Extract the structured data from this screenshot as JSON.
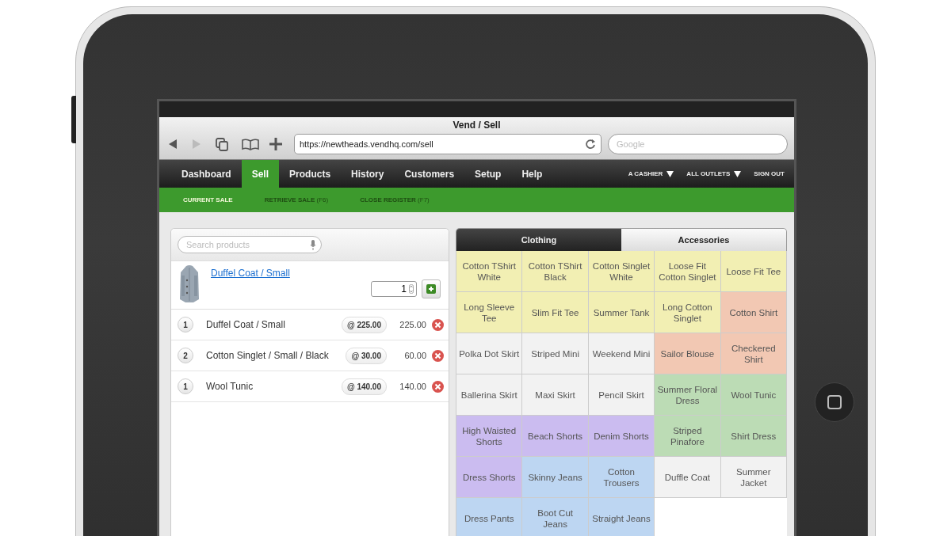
{
  "browser": {
    "title": "Vend / Sell",
    "url": "https://newtheads.vendhq.com/sell",
    "search_placeholder": "Google"
  },
  "nav": {
    "items": [
      {
        "label": "Dashboard",
        "selected": false
      },
      {
        "label": "Sell",
        "selected": true
      },
      {
        "label": "Products",
        "selected": false
      },
      {
        "label": "History",
        "selected": false
      },
      {
        "label": "Customers",
        "selected": false
      },
      {
        "label": "Setup",
        "selected": false
      },
      {
        "label": "Help",
        "selected": false
      }
    ],
    "menus": [
      {
        "label": "A CASHIER",
        "dropdown": true
      },
      {
        "label": "ALL OUTLETS",
        "dropdown": true
      },
      {
        "label": "SIGN OUT",
        "dropdown": false
      }
    ]
  },
  "subnav": [
    {
      "label": "CURRENT SALE",
      "selected": true
    },
    {
      "label": "RETRIEVE SALE",
      "shortcut": "(F6)",
      "selected": false
    },
    {
      "label": "CLOSE REGISTER",
      "shortcut": "(F7)",
      "selected": false
    }
  ],
  "sale": {
    "search_placeholder": "Search products",
    "product": {
      "kind": "picture",
      "name": "Duffel Coat / Small",
      "quantity": "1"
    },
    "lines": [
      {
        "quantity": "1",
        "name": "Duffel Coat / Small",
        "price": "@ 225.00",
        "total": "225.00"
      },
      {
        "quantity": "2",
        "name": "Cotton Singlet / Small / Black",
        "price": "@ 30.00",
        "total": "60.00"
      },
      {
        "quantity": "1",
        "name": "Wool Tunic",
        "price": "@ 140.00",
        "total": "140.00"
      }
    ]
  },
  "tabs": [
    {
      "label": "Clothing",
      "selected": true
    },
    {
      "label": "Accessories",
      "selected": false
    }
  ],
  "products": [
    {
      "label": "Cotton TShirt White",
      "color": "#f2efb3"
    },
    {
      "label": "Cotton TShirt Black",
      "color": "#f2efb3"
    },
    {
      "label": "Cotton Singlet White",
      "color": "#f2efb3"
    },
    {
      "label": "Loose Fit Cotton Singlet",
      "color": "#f2efb3"
    },
    {
      "label": "Loose Fit Tee",
      "color": "#f2efb3"
    },
    {
      "label": "Long Sleeve Tee",
      "color": "#f2efb3"
    },
    {
      "label": "Slim Fit Tee",
      "color": "#f2efb3"
    },
    {
      "label": "Summer Tank",
      "color": "#f2efb3"
    },
    {
      "label": "Long Cotton Singlet",
      "color": "#f2efb3"
    },
    {
      "label": "Cotton Shirt",
      "color": "#f2c8b3"
    },
    {
      "label": "Polka Dot Skirt",
      "color": "#f2f2f2"
    },
    {
      "label": "Striped Mini",
      "color": "#f2f2f2"
    },
    {
      "label": "Weekend Mini",
      "color": "#f2f2f2"
    },
    {
      "label": "Sailor Blouse",
      "color": "#f2c8b3"
    },
    {
      "label": "Checkered Shirt",
      "color": "#f2c8b3"
    },
    {
      "label": "Ballerina Skirt",
      "color": "#f2f2f2"
    },
    {
      "label": "Maxi Skirt",
      "color": "#f2f2f2"
    },
    {
      "label": "Pencil Skirt",
      "color": "#f2f2f2"
    },
    {
      "label": "Summer Floral Dress",
      "color": "#bcdcb5"
    },
    {
      "label": "Wool Tunic",
      "color": "#bcdcb5"
    },
    {
      "label": "High Waisted Shorts",
      "color": "#cbbcf0"
    },
    {
      "label": "Beach Shorts",
      "color": "#cbbcf0"
    },
    {
      "label": "Denim Shorts",
      "color": "#cbbcf0"
    },
    {
      "label": "Striped Pinafore",
      "color": "#bcdcb5"
    },
    {
      "label": "Shirt Dress",
      "color": "#bcdcb5"
    },
    {
      "label": "Dress Shorts",
      "color": "#cbbcf0"
    },
    {
      "label": "Skinny Jeans",
      "color": "#bdd6f2"
    },
    {
      "label": "Cotton Trousers",
      "color": "#bdd6f2"
    },
    {
      "label": "Duffle Coat",
      "color": "#f2f2f2"
    },
    {
      "label": "Summer Jacket",
      "color": "#f2f2f2"
    },
    {
      "label": "Dress Pants",
      "color": "#bdd6f2"
    },
    {
      "label": "Boot Cut Jeans",
      "color": "#bdd6f2"
    },
    {
      "label": "Straight Jeans",
      "color": "#bdd6f2"
    }
  ]
}
